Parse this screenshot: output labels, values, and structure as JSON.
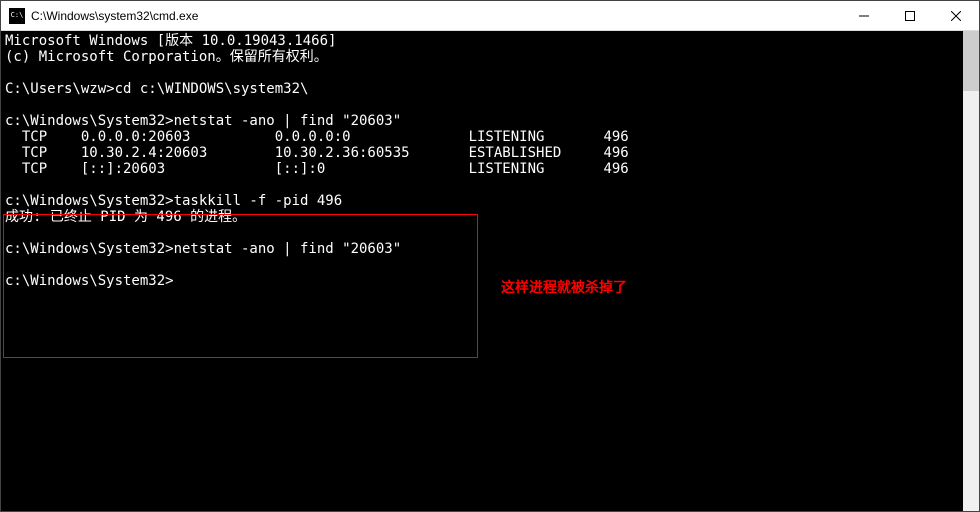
{
  "window": {
    "title": "C:\\Windows\\system32\\cmd.exe"
  },
  "terminal": {
    "banner_line1": "Microsoft Windows [版本 10.0.19043.1466]",
    "banner_line2": "(c) Microsoft Corporation。保留所有权利。",
    "blank1": "",
    "prompt1": "C:\\Users\\wzw>cd c:\\WINDOWS\\system32\\",
    "blank2": "",
    "prompt2": "c:\\Windows\\System32>netstat -ano | find \"20603\"",
    "row1": "  TCP    0.0.0.0:20603          0.0.0.0:0              LISTENING       496",
    "row2": "  TCP    10.30.2.4:20603        10.30.2.36:60535       ESTABLISHED     496",
    "row3": "  TCP    [::]:20603             [::]:0                 LISTENING       496",
    "blank3": "",
    "prompt3": "c:\\Windows\\System32>taskkill -f -pid 496",
    "kill_result": "成功: 已终止 PID 为 496 的进程。",
    "blank4": "",
    "prompt4": "c:\\Windows\\System32>netstat -ano | find \"20603\"",
    "blank5": "",
    "prompt5": "c:\\Windows\\System32>"
  },
  "annotation": {
    "text": "这样进程就被杀掉了"
  },
  "netstat_data": {
    "port_filter": "20603",
    "rows_before_kill": [
      {
        "proto": "TCP",
        "local": "0.0.0.0:20603",
        "foreign": "0.0.0.0:0",
        "state": "LISTENING",
        "pid": 496
      },
      {
        "proto": "TCP",
        "local": "10.30.2.4:20603",
        "foreign": "10.30.2.36:60535",
        "state": "ESTABLISHED",
        "pid": 496
      },
      {
        "proto": "TCP",
        "local": "[::]:20603",
        "foreign": "[::]:0",
        "state": "LISTENING",
        "pid": 496
      }
    ],
    "killed_pid": 496,
    "rows_after_kill": []
  }
}
